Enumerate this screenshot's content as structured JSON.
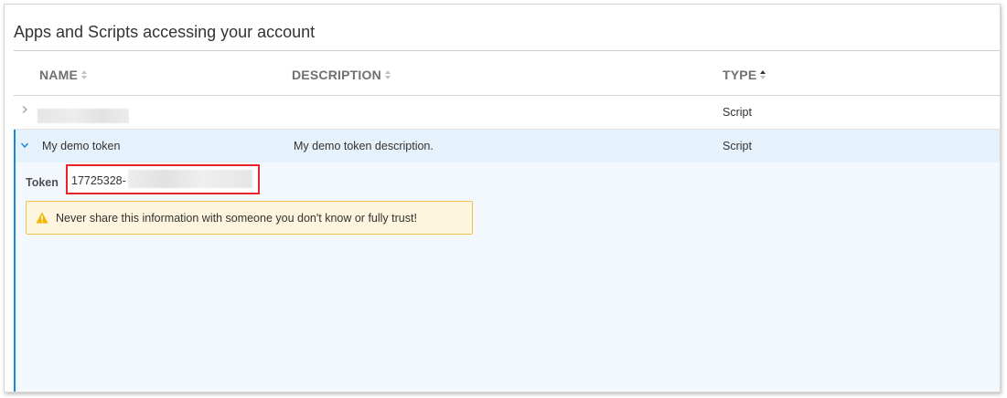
{
  "panel": {
    "title": "Apps and Scripts accessing your account"
  },
  "table": {
    "columns": [
      {
        "label": "NAME",
        "sort": "none"
      },
      {
        "label": "DESCRIPTION",
        "sort": "none"
      },
      {
        "label": "TYPE",
        "sort": "ascending"
      }
    ],
    "rows": [
      {
        "name": "",
        "description": "",
        "type": "Script",
        "expanded": false,
        "name_redacted": true
      },
      {
        "name": "My demo token",
        "description": "My demo token description.",
        "type": "Script",
        "expanded": true
      }
    ]
  },
  "detail": {
    "token_label": "Token",
    "token_value": "17725328-",
    "warning": "Never share this information with someone you don't know or fully trust!"
  },
  "colors": {
    "accent": "#1a8ad4",
    "selected_row": "#e5f1fb",
    "highlight_border": "#e8232b",
    "warning_border": "#f0c14b",
    "warning_bg": "#fdf5de"
  },
  "icons": [
    "chevron-right-icon",
    "chevron-down-icon",
    "warning-icon",
    "sort-icon"
  ]
}
